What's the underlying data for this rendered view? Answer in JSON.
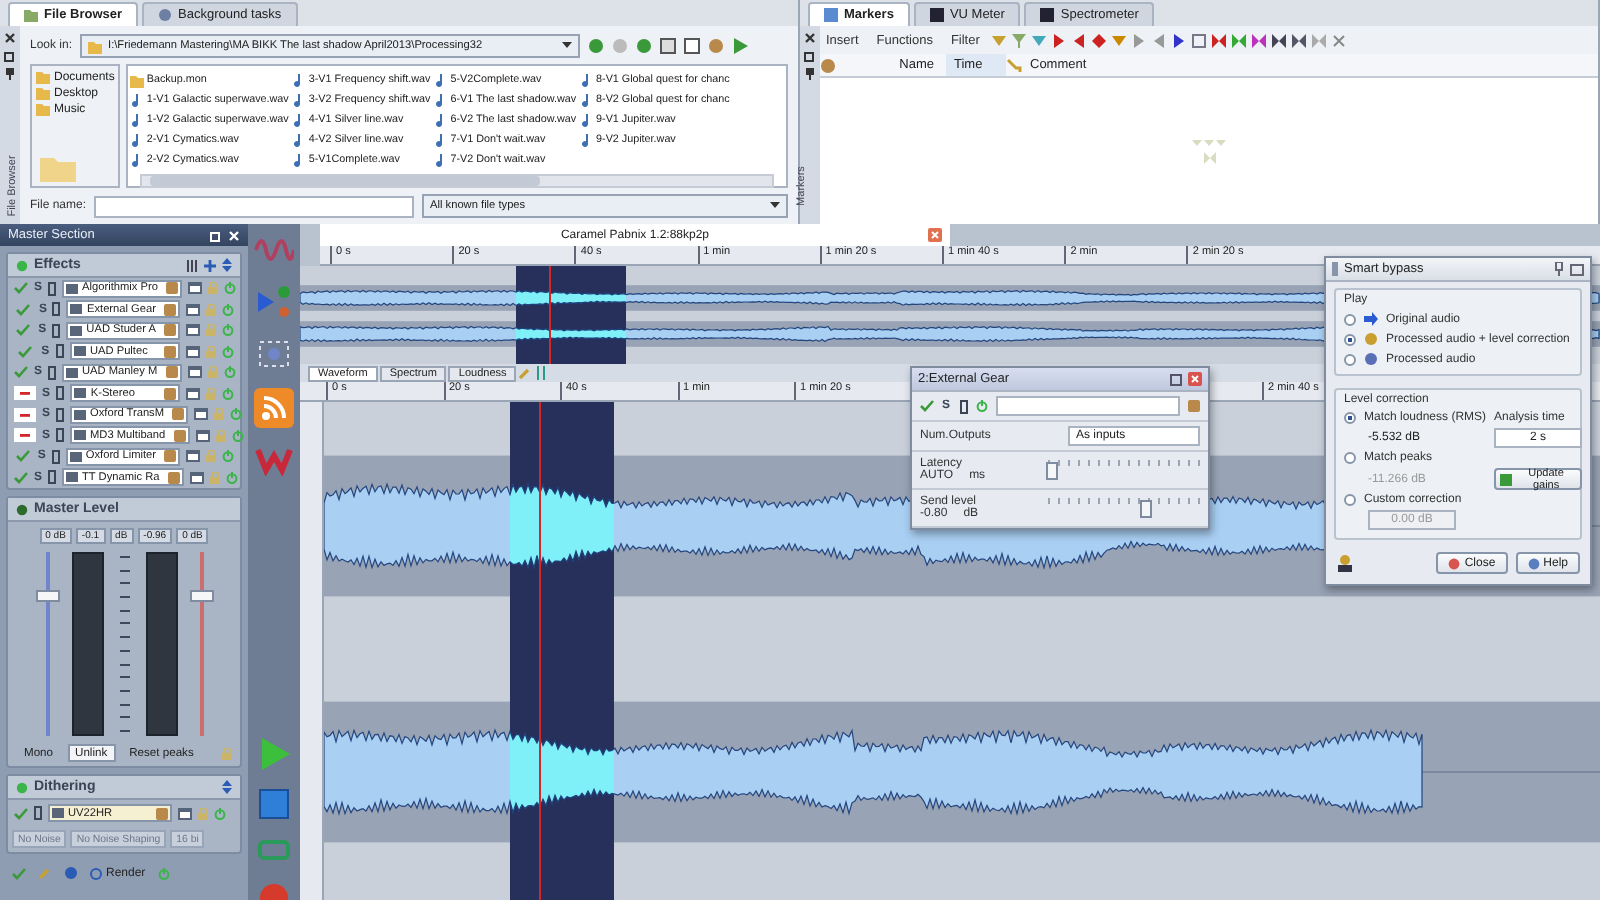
{
  "file_browser": {
    "tabs": [
      {
        "label": "File Browser",
        "selected": true
      },
      {
        "label": "Background tasks",
        "selected": false
      }
    ],
    "side_label": "File Browser",
    "look_in_label": "Look in:",
    "path": "I:\\Friedemann Mastering\\MA BIKK The last shadow April2013\\Processing32",
    "places": [
      "Documents",
      "Desktop",
      "Music"
    ],
    "files": [
      {
        "name": "Backup.mon",
        "kind": "folder"
      },
      {
        "name": "1-V1 Galactic superwave.wav",
        "kind": "audio"
      },
      {
        "name": "1-V2 Galactic superwave.wav",
        "kind": "audio"
      },
      {
        "name": "2-V1 Cymatics.wav",
        "kind": "audio"
      },
      {
        "name": "2-V2 Cymatics.wav",
        "kind": "audio"
      },
      {
        "name": "3-V1 Frequency shift.wav",
        "kind": "audio"
      },
      {
        "name": "3-V2 Frequency shift.wav",
        "kind": "audio"
      },
      {
        "name": "4-V1 Silver line.wav",
        "kind": "audio"
      },
      {
        "name": "4-V2 Silver line.wav",
        "kind": "audio"
      },
      {
        "name": "5-V1Complete.wav",
        "kind": "audio"
      },
      {
        "name": "5-V2Complete.wav",
        "kind": "audio"
      },
      {
        "name": "6-V1 The last shadow.wav",
        "kind": "audio"
      },
      {
        "name": "6-V2 The last shadow.wav",
        "kind": "audio"
      },
      {
        "name": "7-V1 Don't wait.wav",
        "kind": "audio"
      },
      {
        "name": "7-V2 Don't wait.wav",
        "kind": "audio"
      },
      {
        "name": "8-V1 Global quest for chanc",
        "kind": "audio"
      },
      {
        "name": "8-V2 Global quest for chanc",
        "kind": "audio"
      },
      {
        "name": "9-V1 Jupiter.wav",
        "kind": "audio"
      },
      {
        "name": "9-V2 Jupiter.wav",
        "kind": "audio"
      }
    ],
    "file_name_label": "File name:",
    "file_type": "All known file types"
  },
  "markers": {
    "tabs": [
      {
        "label": "Markers",
        "selected": true
      },
      {
        "label": "VU Meter",
        "selected": false
      },
      {
        "label": "Spectrometer",
        "selected": false
      }
    ],
    "side_label": "Markers",
    "menus": [
      "Insert",
      "Functions",
      "Filter"
    ],
    "columns": [
      "Name",
      "Time",
      "Comment"
    ]
  },
  "master": {
    "title": "Master Section",
    "effects_title": "Effects",
    "effects": [
      {
        "name": "Algorithmix Pro",
        "solo": "S",
        "enabled": true
      },
      {
        "name": "External Gear",
        "solo": "S",
        "enabled": true
      },
      {
        "name": "UAD Studer A",
        "solo": "S",
        "enabled": true
      },
      {
        "name": "UAD Pultec",
        "solo": "S",
        "enabled": true
      },
      {
        "name": "UAD Manley M",
        "solo": "S",
        "enabled": true
      },
      {
        "name": "K-Stereo",
        "solo": "S",
        "enabled": false
      },
      {
        "name": "Oxford TransM",
        "solo": "S",
        "enabled": false
      },
      {
        "name": "MD3 Multiband",
        "solo": "S",
        "enabled": false
      },
      {
        "name": "Oxford Limiter",
        "solo": "S",
        "enabled": true
      },
      {
        "name": "TT Dynamic Ra",
        "solo": "S",
        "enabled": true
      }
    ],
    "level_title": "Master Level",
    "readouts": [
      "0 dB",
      "-0.1",
      "dB",
      "-0.96",
      "0 dB"
    ],
    "faders": [
      {
        "level": 0.77
      },
      {
        "level": 0.77
      }
    ],
    "buttons": [
      {
        "label": "Mono",
        "selected": false
      },
      {
        "label": "Unlink",
        "selected": true
      },
      {
        "label": "Reset peaks",
        "selected": false
      }
    ],
    "dithering_title": "Dithering",
    "dither_plugin": "UV22HR",
    "dither_options": [
      "No Noise",
      "No Noise Shaping",
      "16 bi"
    ],
    "render": "Render"
  },
  "waveform_window": {
    "title": "Caramel Pabnix 1.2:88kp2p",
    "overview_ticks": [
      "0 s",
      "20 s",
      "40 s",
      "1 min",
      "1 min 20 s",
      "1 min 40 s",
      "2 min",
      "2 min 20 s"
    ],
    "view_tabs": [
      {
        "label": "Waveform",
        "selected": true
      },
      {
        "label": "Spectrum",
        "selected": false
      },
      {
        "label": "Loudness",
        "selected": false
      }
    ],
    "main_ticks": [
      "0 s",
      "20 s",
      "40 s",
      "1 min",
      "1 min 20 s"
    ],
    "main_ticks_end": "2 min 40 s"
  },
  "external_gear": {
    "title": "2:External Gear",
    "solo": "S",
    "outputs_label": "Num.Outputs",
    "outputs_value": "As inputs",
    "latency": {
      "label": "Latency",
      "value": "AUTO",
      "unit": "ms",
      "level": 0.02
    },
    "send_level": {
      "label": "Send level",
      "value": "-0.80",
      "unit": "dB",
      "level": 0.65
    }
  },
  "smart_bypass": {
    "title": "Smart bypass",
    "play_title": "Play",
    "play": [
      {
        "label": "Original audio",
        "selected": false
      },
      {
        "label": "Processed audio + level correction",
        "selected": true
      },
      {
        "label": "Processed audio",
        "selected": false
      }
    ],
    "level_title": "Level correction",
    "corrections": [
      {
        "label": "Match loudness (RMS)",
        "selected": true,
        "reading": "-5.532 dB"
      },
      {
        "label": "Match peaks",
        "selected": false,
        "reading": "-11.266 dB"
      },
      {
        "label": "Custom correction",
        "selected": false,
        "reading": "0.00 dB"
      }
    ],
    "analysis_label": "Analysis time",
    "analysis_value": "2 s",
    "update": "Update gains",
    "buttons": [
      "Close",
      "Help"
    ]
  }
}
